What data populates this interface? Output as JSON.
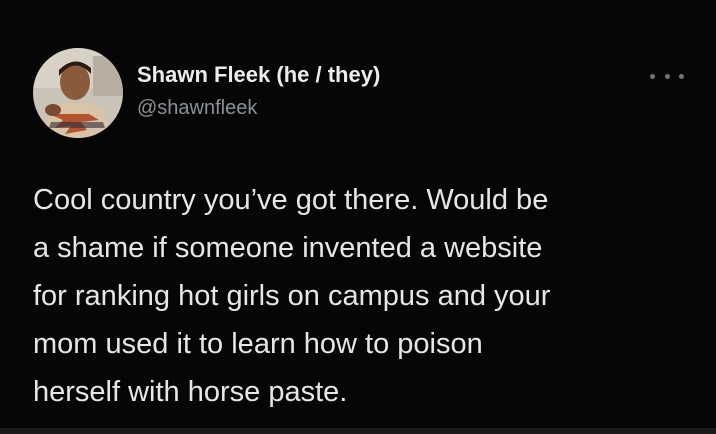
{
  "tweet": {
    "author_name": "Shawn Fleek (he / they)",
    "handle": "@shawnfleek",
    "text_lines": [
      "Cool country you’ve got there. Would be",
      "a shame if someone invented a website",
      "for ranking hot girls on campus and your",
      "mom used it to learn how to poison",
      "herself with horse paste."
    ]
  },
  "icons": {
    "more": "more-options-icon",
    "avatar": "avatar"
  },
  "colors": {
    "background": "#060606",
    "name": "#ececec",
    "handle": "#8b9096",
    "text": "#e4e6e7"
  }
}
